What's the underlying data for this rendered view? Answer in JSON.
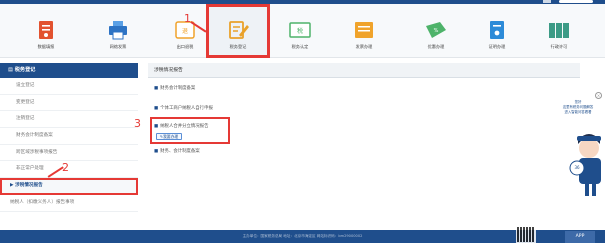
{
  "nav": {
    "items": [
      {
        "label": "数据填报",
        "icon": "tax-doc-icon",
        "color": "#e2522f"
      },
      {
        "label": "网络发票",
        "icon": "printer-icon",
        "color": "#2d73c4"
      },
      {
        "label": "出口退税",
        "icon": "export-refund-icon",
        "color": "#f0a32b"
      },
      {
        "label": "税务登记",
        "icon": "registration-icon",
        "color": "#e9a12a"
      },
      {
        "label": "税务认定",
        "icon": "tax-certify-icon",
        "color": "#4eb36a"
      },
      {
        "label": "发票办理",
        "icon": "invoice-icon",
        "color": "#f0a32b"
      },
      {
        "label": "优惠办理",
        "icon": "discount-icon",
        "color": "#4eb36a"
      },
      {
        "label": "证明办理",
        "icon": "certificate-icon",
        "color": "#2d8bd8"
      },
      {
        "label": "行政许可",
        "icon": "admin-permit-icon",
        "color": "#3c9b86"
      }
    ]
  },
  "sidebar": {
    "title": "税务登记",
    "items": [
      {
        "label": "设立登记"
      },
      {
        "label": "变更登记"
      },
      {
        "label": "注销登记"
      },
      {
        "label": "财务会计制度备案"
      },
      {
        "label": "跨区域涉税事项报告"
      },
      {
        "label": "非正常户处理"
      },
      {
        "label": "涉税情况报告"
      },
      {
        "label": "纳税人（扣缴义务人）报告事项"
      }
    ]
  },
  "content": {
    "header": "涉税情况报告",
    "items": [
      {
        "text": "财务会计制度备案"
      },
      {
        "text": "个体工商户纳税人自行申报"
      },
      {
        "text": "纳税人合并分立情况报告"
      },
      {
        "text": "财务、会计制度备案"
      }
    ],
    "process_button": "我要办理"
  },
  "annotations": {
    "one": "1",
    "two": "2",
    "three": "3"
  },
  "help": {
    "line1": "您好",
    "line2": "这里有税务问题解答",
    "line3": "进入智能问答看看"
  },
  "mascot_badge": "36",
  "footer": {
    "text": "主办单位：国家税务总局 地址：北京市海淀区 网站标识码：bm29000002",
    "qr_side": "APP"
  },
  "colors": {
    "brand": "#1f4e8c",
    "annotation": "#e53935"
  }
}
